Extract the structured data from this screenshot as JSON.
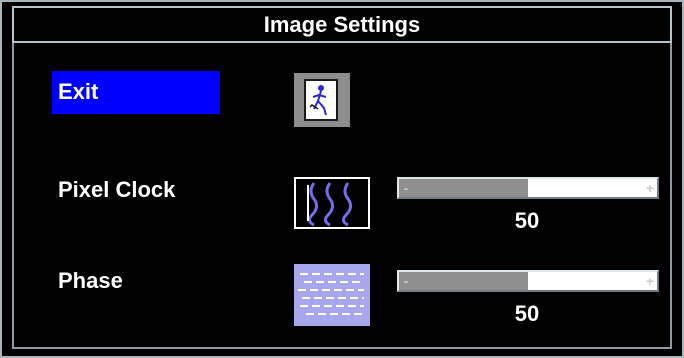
{
  "title": "Image Settings",
  "menu": {
    "exit": {
      "label": "Exit",
      "icon": "exit-door-icon",
      "highlight_color": "#0000ff",
      "selected": true
    },
    "pixel_clock": {
      "label": "Pixel Clock",
      "icon": "pixel-clock-wave-icon",
      "value": "50",
      "level_fraction": 0.5,
      "minus": "-",
      "plus": "+"
    },
    "phase": {
      "label": "Phase",
      "icon": "phase-lines-icon",
      "value": "50",
      "level_fraction": 0.5,
      "minus": "-",
      "plus": "+"
    }
  },
  "colors": {
    "background": "#000000",
    "text": "#ffffff",
    "selection": "#0000ff",
    "slider_fill": "#8f8f8f",
    "slider_track": "#ffffff",
    "icon_accent": "#2a2ad8"
  }
}
